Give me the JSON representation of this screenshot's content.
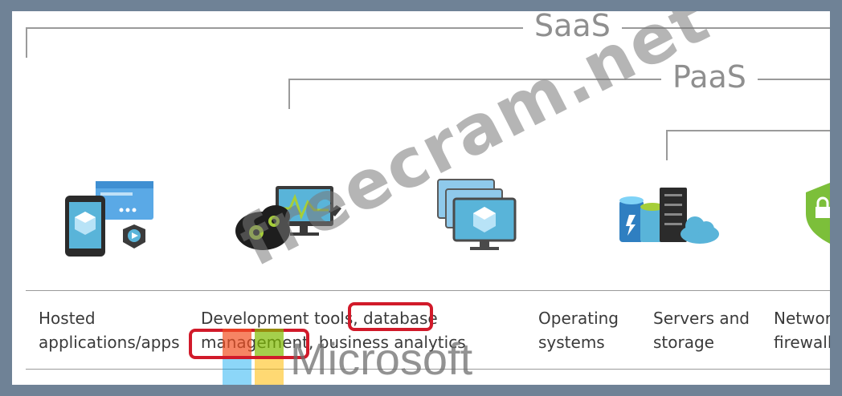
{
  "diagram": {
    "tiers": {
      "saas": "SaaS",
      "paas": "PaaS"
    },
    "columns": [
      {
        "id": "apps",
        "icon": "hosted-apps-icon",
        "line1": "Hosted",
        "line2": "applications/apps"
      },
      {
        "id": "devtools",
        "icon": "dev-tools-icon",
        "line1_a": "Development tools, ",
        "line1_b": "database",
        "line2_a": "management",
        "line2_b": ", business analytics"
      },
      {
        "id": "os",
        "icon": "operating-systems-icon",
        "line1": "Operating",
        "line2": "systems"
      },
      {
        "id": "servers",
        "icon": "servers-storage-icon",
        "line1": "Servers and",
        "line2": "storage"
      },
      {
        "id": "network",
        "icon": "network-firewall-icon",
        "line1": "Networ",
        "line2": "firewalls"
      }
    ],
    "highlight_color": "#d11a2a"
  },
  "overlay": {
    "watermark": "freecram.net",
    "brand": "Microsoft"
  }
}
